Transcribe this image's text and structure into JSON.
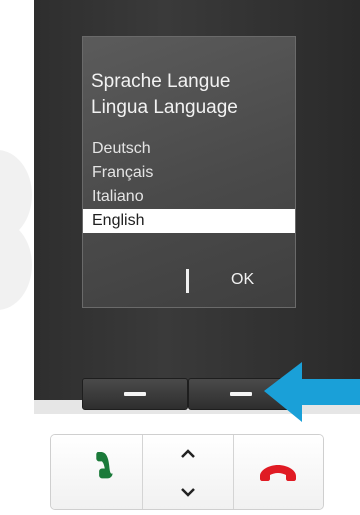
{
  "display": {
    "title_line1": "Sprache Langue",
    "title_line2": "Lingua Language",
    "languages": [
      {
        "label": "Deutsch",
        "selected": false
      },
      {
        "label": "Français",
        "selected": false
      },
      {
        "label": "Italiano",
        "selected": false
      },
      {
        "label": "English",
        "selected": true
      }
    ],
    "softkey_right_label": "OK"
  },
  "icons": {
    "call_icon": "phone-handset-icon",
    "end_icon": "hang-up-icon",
    "nav_up_icon": "chevron-up-icon",
    "nav_down_icon": "chevron-down-icon",
    "arrow_icon": "pointer-arrow-icon"
  },
  "colors": {
    "call_green": "#1b7a3a",
    "end_red": "#e01b24",
    "arrow_blue": "#1aa0d8",
    "selected_row": "#ffffff"
  }
}
